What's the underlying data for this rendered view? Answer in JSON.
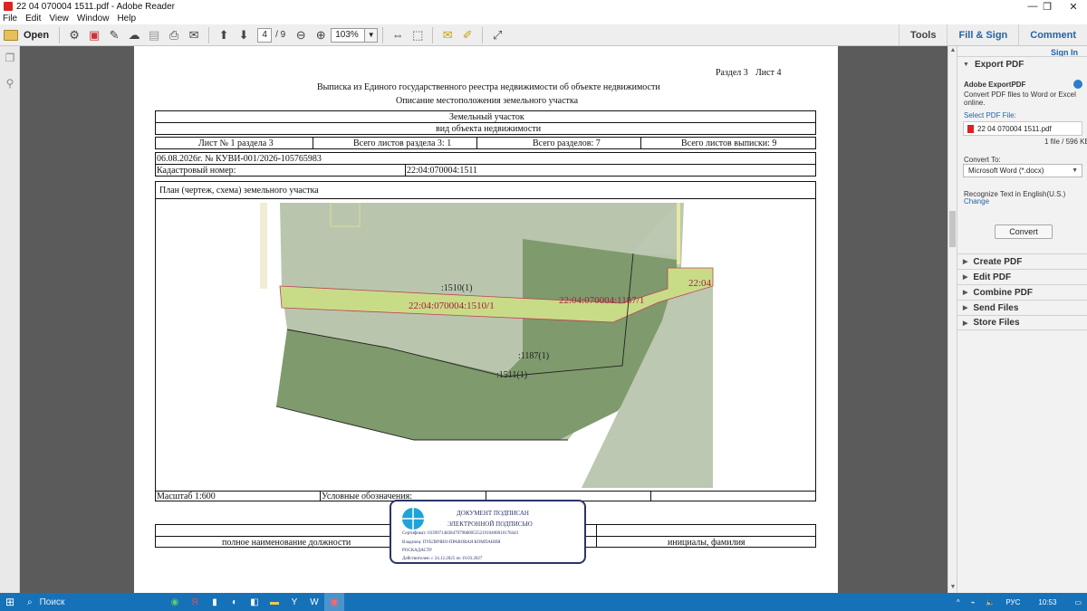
{
  "window": {
    "title": "22 04 070004 1511.pdf - Adobe Reader",
    "minimize": "—",
    "restore": "❐",
    "close": "✕"
  },
  "menu": [
    "File",
    "Edit",
    "View",
    "Window",
    "Help"
  ],
  "toolbar": {
    "open_label": "Open",
    "page_current": "4",
    "page_total": "/ 9",
    "zoom": "103%",
    "right_tabs": [
      "Tools",
      "Fill & Sign",
      "Comment"
    ]
  },
  "document": {
    "header_section": "Раздел 3",
    "header_sheet": "Лист 4",
    "title1": "Выписка из Единого государственного реестра недвижимости об объекте недвижимости",
    "title2": "Описание местоположения земельного участка",
    "object": "Земельный участок",
    "object_sub": "вид объекта недвижимости",
    "info_row": [
      "Лист № 1 раздела 3",
      "Всего листов раздела 3: 1",
      "Всего разделов: 7",
      "Всего листов выписки: 9"
    ],
    "date_number": "06.08.2026г. № КУВИ-001/2026-105765983",
    "cadastral_label": "Кадастровый номер:",
    "cadastral_value": "22:04:070004:1511",
    "plan_title": "План (чертеж, схема) земельного участка",
    "map_labels": {
      "p1510": ":1510(1)",
      "p1510_full": "22:04:070004:1510/1",
      "p1187_full": "22:04:070004:1187/1",
      "p22_04": "22:04",
      "p1187": ":1187(1)",
      "p1511": ":1511(1)"
    },
    "scale": "Масштаб 1:600",
    "legend": "Условные обозначения:",
    "sig_left": "полное наименование должности",
    "sig_right": "инициалы, фамилия"
  },
  "stamp": {
    "line1": "ДОКУМЕНТ ПОДПИСАН",
    "line2": "ЭЛЕКТРОННОЙ ПОДПИСЬЮ",
    "cert": "Сертификат: 0339971483847979880055521910400010178443",
    "owner": "Владелец: ПУБЛИЧНО-ПРАВОВАЯ КОМПАНИЯ",
    "owner2": "РОСКАДАСТР",
    "valid": "Действителен: с 24.12.2025 по 19.03.2027"
  },
  "right_panel": {
    "sign_in": "Sign In",
    "export_header": "Export PDF",
    "service": "Adobe ExportPDF",
    "desc1": "Convert PDF files to Word or Excel",
    "desc2": "online.",
    "select_label": "Select PDF File:",
    "file": "22 04 070004 1511.pdf",
    "file_count": "1 file / 596 KB",
    "convert_to_label": "Convert To:",
    "convert_to_value": "Microsoft Word (*.docx)",
    "recognize": "Recognize Text in English(U.S.)",
    "change": "Change",
    "convert_btn": "Convert",
    "sections": [
      "Create PDF",
      "Edit PDF",
      "Combine PDF",
      "Send Files",
      "Store Files"
    ]
  },
  "taskbar": {
    "search": "Поиск",
    "lang": "РУС",
    "time": "10:53"
  },
  "colors": {
    "accent": "#2463a8",
    "taskbar": "#1672b8",
    "parcel_light": "#b9c6ad",
    "parcel_dark": "#7f9a6d",
    "road": "#c8dc88",
    "label_red": "#a5213a"
  }
}
